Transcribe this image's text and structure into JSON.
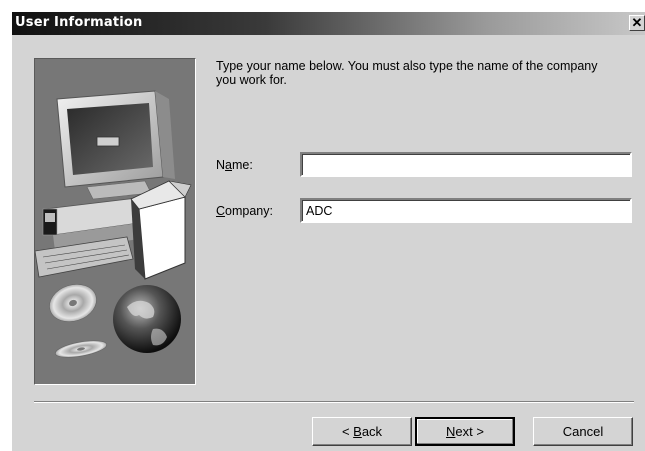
{
  "window": {
    "title": "User Information",
    "close_icon": "close-icon"
  },
  "instructions": "Type your name below. You must also type the name of the company you work for.",
  "fields": {
    "name": {
      "label_pre": "N",
      "label_mnemonic": "a",
      "label_post": "me:",
      "value": ""
    },
    "company": {
      "label_pre": "",
      "label_mnemonic": "C",
      "label_post": "ompany:",
      "value": "ADC"
    }
  },
  "buttons": {
    "back": {
      "pre": "< ",
      "mnemonic": "B",
      "post": "ack"
    },
    "next": {
      "pre": "",
      "mnemonic": "N",
      "post": "ext >"
    },
    "cancel": "Cancel"
  },
  "illustration": "computer-and-globe-illustration",
  "colors": {
    "dialog_bg": "#d4d4d4",
    "panel_bg": "#777777"
  }
}
